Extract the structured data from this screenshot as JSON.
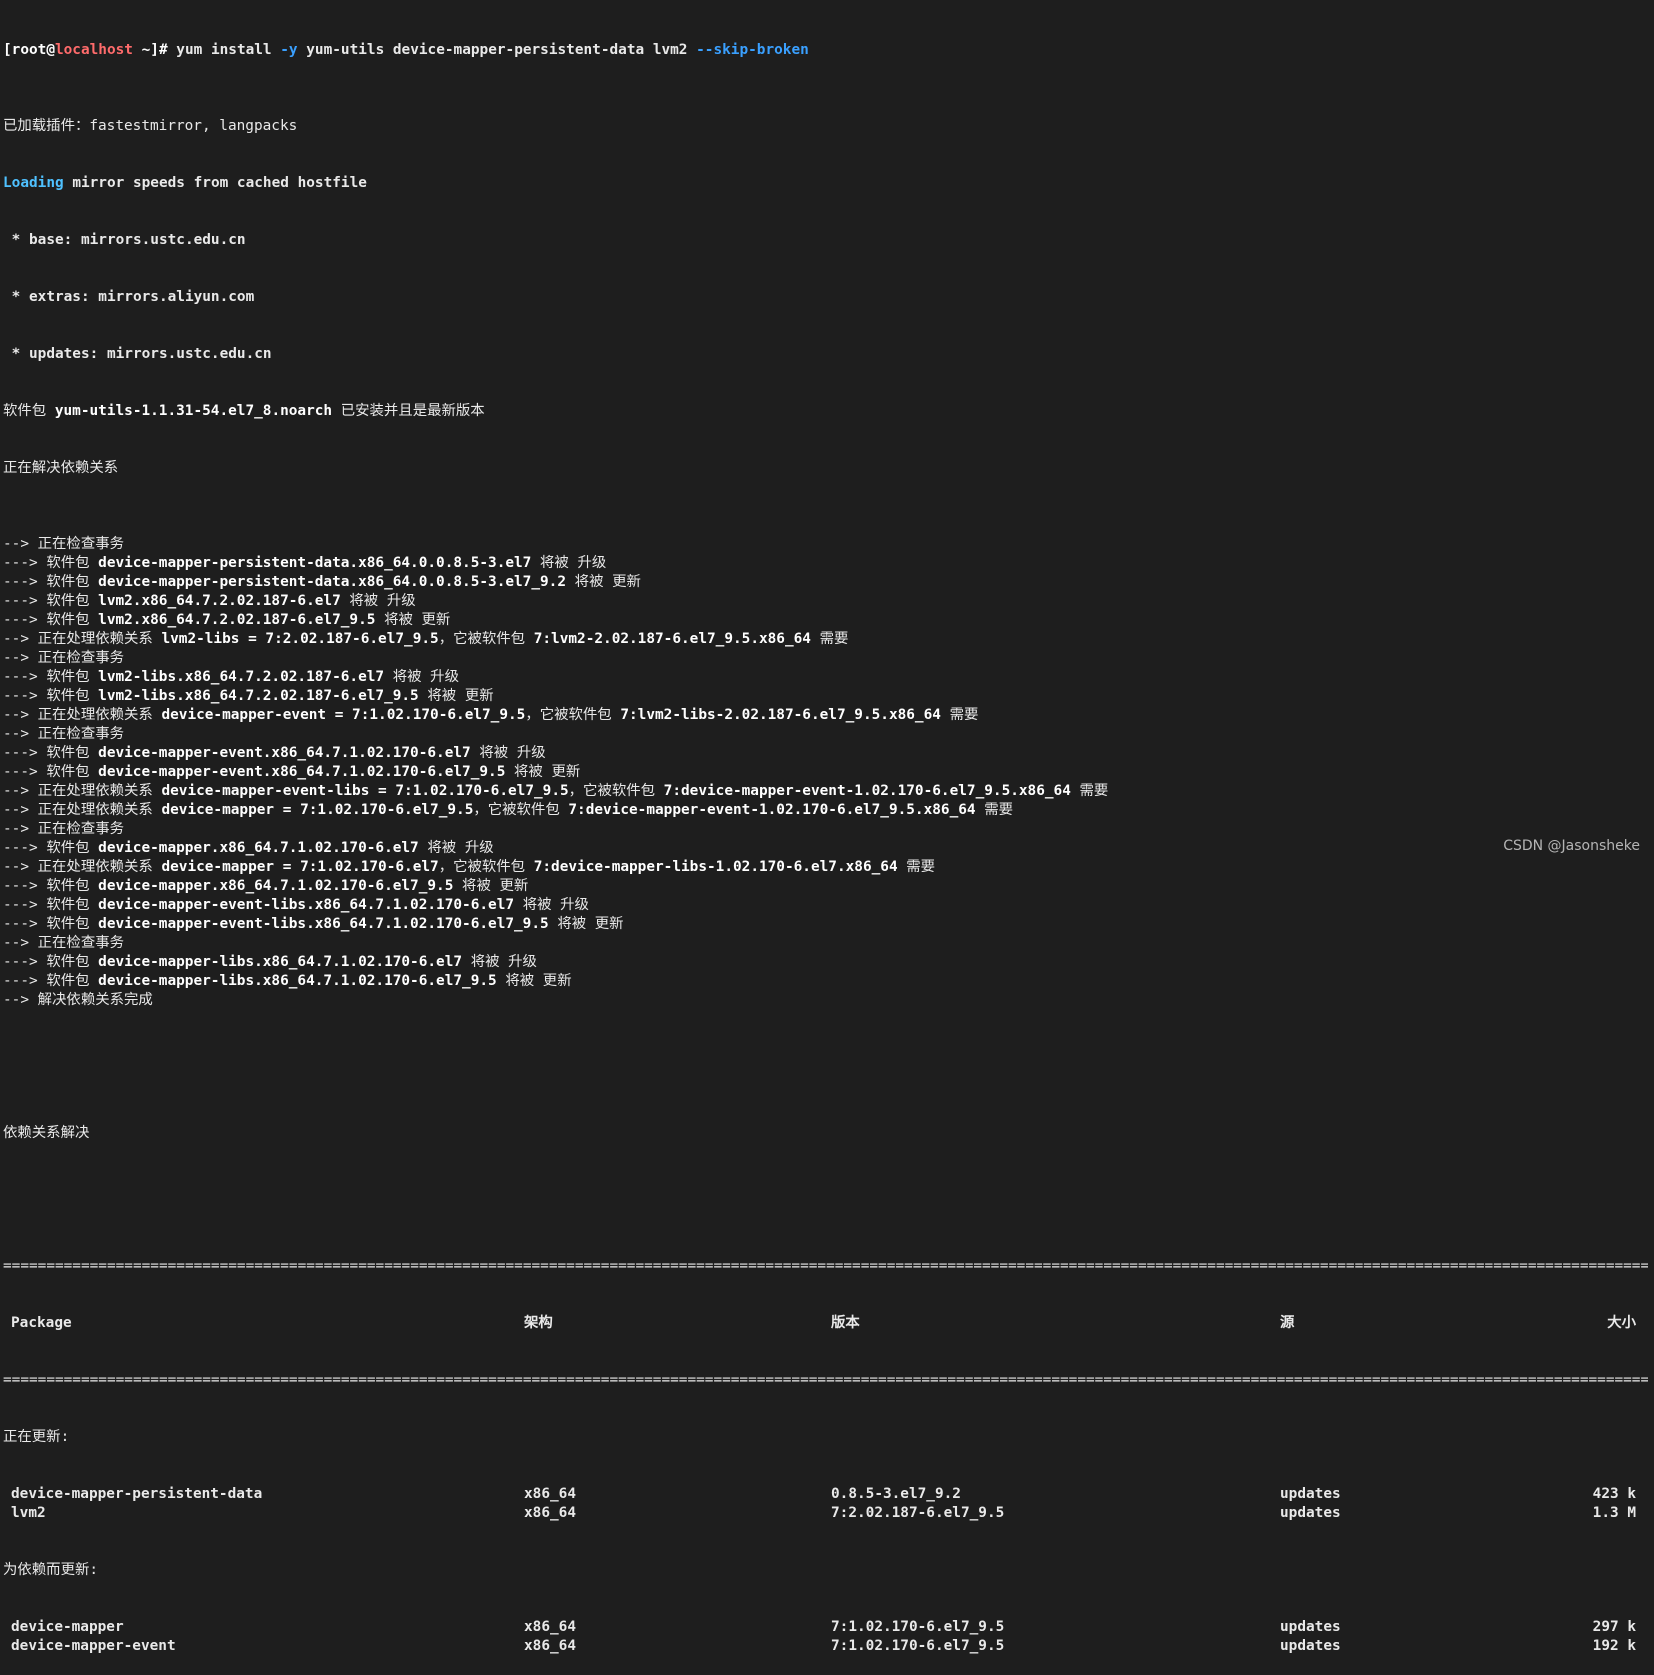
{
  "prompt": {
    "user_prefix": "[root@",
    "host": "localhost",
    "path_suffix": " ~]# ",
    "cmd1": "yum install ",
    "flag_y": "-y",
    "cmd2": " yum-utils device-mapper-persistent-data lvm2 ",
    "flag_skip": "--skip-broken"
  },
  "header_lines": {
    "plugins": "已加载插件：fastestmirror, langpacks",
    "loading_word": "Loading",
    "loading_rest": " mirror speeds from cached hostfile",
    "base": " * base: mirrors.ustc.edu.cn",
    "extras": " * extras: mirrors.aliyun.com",
    "updates": " * updates: mirrors.ustc.edu.cn",
    "installed_pre": "软件包 ",
    "installed_pkg": "yum-utils-1.1.31-54.el7_8.noarch",
    "installed_post": " 已安装并且是最新版本",
    "resolving": "正在解决依赖关系"
  },
  "log": [
    {
      "a": "--> 正在检查事务",
      "b": "",
      "c": ""
    },
    {
      "a": "---> 软件包 ",
      "b": "device-mapper-persistent-data.x86_64.0.0.8.5-3.el7",
      "c": " 将被 升级"
    },
    {
      "a": "---> 软件包 ",
      "b": "device-mapper-persistent-data.x86_64.0.0.8.5-3.el7_9.2",
      "c": " 将被 更新"
    },
    {
      "a": "---> 软件包 ",
      "b": "lvm2.x86_64.7.2.02.187-6.el7",
      "c": " 将被 升级"
    },
    {
      "a": "---> 软件包 ",
      "b": "lvm2.x86_64.7.2.02.187-6.el7_9.5",
      "c": " 将被 更新"
    },
    {
      "a": "--> 正在处理依赖关系 ",
      "b": "lvm2-libs = 7:2.02.187-6.el7_9.5",
      "c": "，它被软件包 ",
      "d": "7:lvm2-2.02.187-6.el7_9.5.x86_64",
      "e": " 需要"
    },
    {
      "a": "--> 正在检查事务",
      "b": "",
      "c": ""
    },
    {
      "a": "---> 软件包 ",
      "b": "lvm2-libs.x86_64.7.2.02.187-6.el7",
      "c": " 将被 升级"
    },
    {
      "a": "---> 软件包 ",
      "b": "lvm2-libs.x86_64.7.2.02.187-6.el7_9.5",
      "c": " 将被 更新"
    },
    {
      "a": "--> 正在处理依赖关系 ",
      "b": "device-mapper-event = 7:1.02.170-6.el7_9.5",
      "c": "，它被软件包 ",
      "d": "7:lvm2-libs-2.02.187-6.el7_9.5.x86_64",
      "e": " 需要"
    },
    {
      "a": "--> 正在检查事务",
      "b": "",
      "c": ""
    },
    {
      "a": "---> 软件包 ",
      "b": "device-mapper-event.x86_64.7.1.02.170-6.el7",
      "c": " 将被 升级"
    },
    {
      "a": "---> 软件包 ",
      "b": "device-mapper-event.x86_64.7.1.02.170-6.el7_9.5",
      "c": " 将被 更新"
    },
    {
      "a": "--> 正在处理依赖关系 ",
      "b": "device-mapper-event-libs = 7:1.02.170-6.el7_9.5",
      "c": "，它被软件包 ",
      "d": "7:device-mapper-event-1.02.170-6.el7_9.5.x86_64",
      "e": " 需要"
    },
    {
      "a": "--> 正在处理依赖关系 ",
      "b": "device-mapper = 7:1.02.170-6.el7_9.5",
      "c": "，它被软件包 ",
      "d": "7:device-mapper-event-1.02.170-6.el7_9.5.x86_64",
      "e": " 需要"
    },
    {
      "a": "--> 正在检查事务",
      "b": "",
      "c": ""
    },
    {
      "a": "---> 软件包 ",
      "b": "device-mapper.x86_64.7.1.02.170-6.el7",
      "c": " 将被 升级"
    },
    {
      "a": "--> 正在处理依赖关系 ",
      "b": "device-mapper = 7:1.02.170-6.el7",
      "c": "，它被软件包 ",
      "d": "7:device-mapper-libs-1.02.170-6.el7.x86_64",
      "e": " 需要"
    },
    {
      "a": "---> 软件包 ",
      "b": "device-mapper.x86_64.7.1.02.170-6.el7_9.5",
      "c": " 将被 更新"
    },
    {
      "a": "---> 软件包 ",
      "b": "device-mapper-event-libs.x86_64.7.1.02.170-6.el7",
      "c": " 将被 升级"
    },
    {
      "a": "---> 软件包 ",
      "b": "device-mapper-event-libs.x86_64.7.1.02.170-6.el7_9.5",
      "c": " 将被 更新"
    },
    {
      "a": "--> 正在检查事务",
      "b": "",
      "c": ""
    },
    {
      "a": "---> 软件包 ",
      "b": "device-mapper-libs.x86_64.7.1.02.170-6.el7",
      "c": " 将被 升级"
    },
    {
      "a": "---> 软件包 ",
      "b": "device-mapper-libs.x86_64.7.1.02.170-6.el7_9.5",
      "c": " 将被 更新"
    },
    {
      "a": "--> 解决依赖关系完成",
      "b": "",
      "c": ""
    }
  ],
  "resolved_label": "依赖关系解决",
  "table": {
    "headers": [
      "Package",
      "架构",
      "版本",
      "源",
      "大小"
    ],
    "section_updating": "正在更新:",
    "section_dep_updating": "为依赖而更新:",
    "rows_updating": [
      [
        "device-mapper-persistent-data",
        "x86_64",
        "0.8.5-3.el7_9.2",
        "updates",
        "423 k"
      ],
      [
        "lvm2",
        "x86_64",
        "7:2.02.187-6.el7_9.5",
        "updates",
        "1.3 M"
      ]
    ],
    "rows_dep": [
      [
        "device-mapper",
        "x86_64",
        "7:1.02.170-6.el7_9.5",
        "updates",
        "297 k"
      ],
      [
        "device-mapper-event",
        "x86_64",
        "7:1.02.170-6.el7_9.5",
        "updates",
        "192 k"
      ]
    ]
  },
  "watermark": "CSDN @Jasonsheke"
}
